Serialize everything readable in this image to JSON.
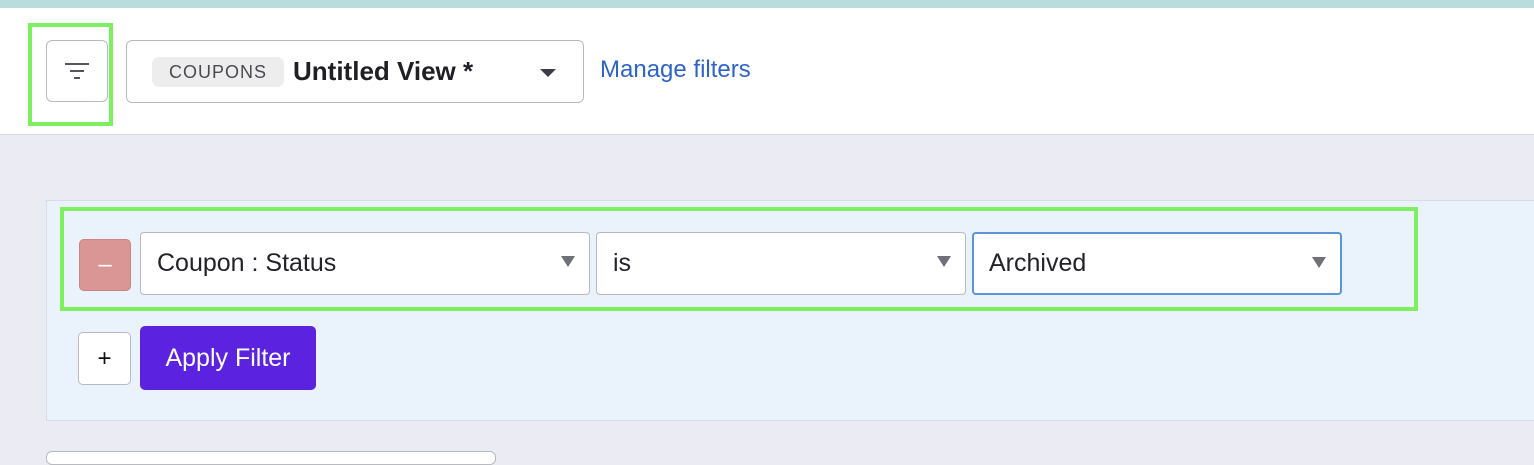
{
  "header": {
    "filter_toggle_icon": "filter-lines-icon",
    "view": {
      "badge": "COUPONS",
      "name": "Untitled View *",
      "caret_icon": "chevron-down-icon"
    },
    "manage_filters_label": "Manage filters"
  },
  "filter_panel": {
    "rows": [
      {
        "remove_label": "–",
        "field": "Coupon : Status",
        "operator": "is",
        "value": "Archived"
      }
    ],
    "add_label": "+",
    "apply_label": "Apply Filter"
  },
  "colors": {
    "accent": "#5b22e0",
    "link": "#2e64c7",
    "highlight": "#7ef060",
    "remove": "#d99695",
    "panel_bg": "#eaf2fb"
  }
}
